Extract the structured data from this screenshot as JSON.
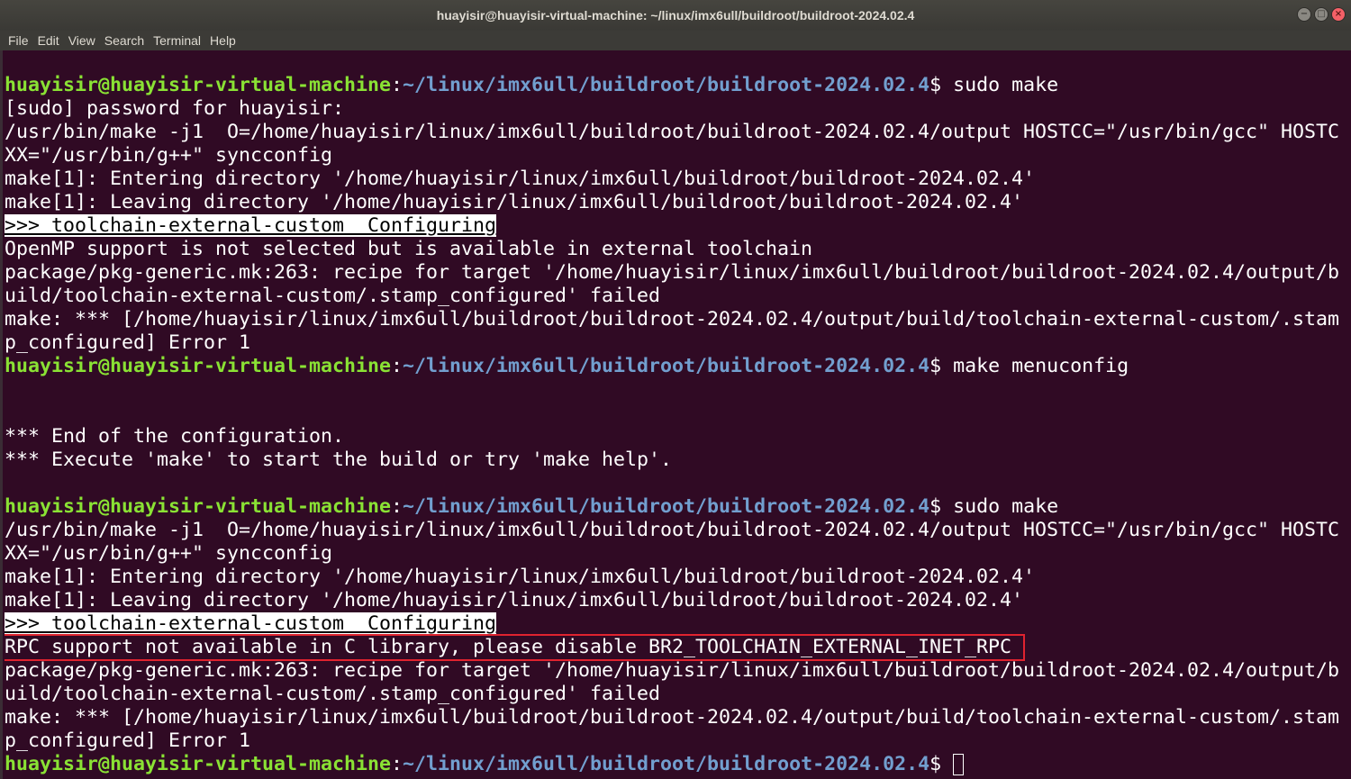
{
  "window": {
    "title": "huayisir@huayisir-virtual-machine: ~/linux/imx6ull/buildroot/buildroot-2024.02.4",
    "controls": {
      "minimize": "−",
      "maximize": "□",
      "close": "×"
    }
  },
  "menu": [
    "File",
    "Edit",
    "View",
    "Search",
    "Terminal",
    "Help"
  ],
  "prompt": {
    "user_host": "huayisir@huayisir-virtual-machine",
    "colon": ":",
    "path": "~/linux/imx6ull/buildroot/buildroot-2024.02.4",
    "symbol": "$"
  },
  "lines": [
    {
      "type": "prompt",
      "cmd": " sudo make"
    },
    {
      "type": "text",
      "text": "[sudo] password for huayisir:"
    },
    {
      "type": "text",
      "text": "/usr/bin/make -j1  O=/home/huayisir/linux/imx6ull/buildroot/buildroot-2024.02.4/output HOSTCC=\"/usr/bin/gcc\" HOSTC"
    },
    {
      "type": "text",
      "text": "XX=\"/usr/bin/g++\" syncconfig"
    },
    {
      "type": "text",
      "text": "make[1]: Entering directory '/home/huayisir/linux/imx6ull/buildroot/buildroot-2024.02.4'"
    },
    {
      "type": "text",
      "text": "make[1]: Leaving directory '/home/huayisir/linux/imx6ull/buildroot/buildroot-2024.02.4'"
    },
    {
      "type": "highlight",
      "text": ">>> toolchain-external-custom  Configuring"
    },
    {
      "type": "text",
      "text": "OpenMP support is not selected but is available in external toolchain"
    },
    {
      "type": "text",
      "text": "package/pkg-generic.mk:263: recipe for target '/home/huayisir/linux/imx6ull/buildroot/buildroot-2024.02.4/output/b"
    },
    {
      "type": "text",
      "text": "uild/toolchain-external-custom/.stamp_configured' failed"
    },
    {
      "type": "text",
      "text": "make: *** [/home/huayisir/linux/imx6ull/buildroot/buildroot-2024.02.4/output/build/toolchain-external-custom/.stam"
    },
    {
      "type": "text",
      "text": "p_configured] Error 1"
    },
    {
      "type": "prompt",
      "cmd": " make menuconfig"
    },
    {
      "type": "text",
      "text": ""
    },
    {
      "type": "text",
      "text": ""
    },
    {
      "type": "text",
      "text": "*** End of the configuration."
    },
    {
      "type": "text",
      "text": "*** Execute 'make' to start the build or try 'make help'."
    },
    {
      "type": "text",
      "text": ""
    },
    {
      "type": "prompt",
      "cmd": " sudo make"
    },
    {
      "type": "text",
      "text": "/usr/bin/make -j1  O=/home/huayisir/linux/imx6ull/buildroot/buildroot-2024.02.4/output HOSTCC=\"/usr/bin/gcc\" HOSTC"
    },
    {
      "type": "text",
      "text": "XX=\"/usr/bin/g++\" syncconfig"
    },
    {
      "type": "text",
      "text": "make[1]: Entering directory '/home/huayisir/linux/imx6ull/buildroot/buildroot-2024.02.4'"
    },
    {
      "type": "text",
      "text": "make[1]: Leaving directory '/home/huayisir/linux/imx6ull/buildroot/buildroot-2024.02.4'"
    },
    {
      "type": "highlight",
      "text": ">>> toolchain-external-custom  Configuring"
    },
    {
      "type": "boxed",
      "text": "RPC support not available in C library, please disable BR2_TOOLCHAIN_EXTERNAL_INET_RPC "
    },
    {
      "type": "text",
      "text": "package/pkg-generic.mk:263: recipe for target '/home/huayisir/linux/imx6ull/buildroot/buildroot-2024.02.4/output/b"
    },
    {
      "type": "text",
      "text": "uild/toolchain-external-custom/.stamp_configured' failed"
    },
    {
      "type": "text",
      "text": "make: *** [/home/huayisir/linux/imx6ull/buildroot/buildroot-2024.02.4/output/build/toolchain-external-custom/.stam"
    },
    {
      "type": "text",
      "text": "p_configured] Error 1"
    },
    {
      "type": "prompt-cursor",
      "cmd": " "
    }
  ],
  "colors": {
    "background": "#300a24",
    "prompt_user": "#8ae234",
    "prompt_path": "#729fcf",
    "text": "#ffffff",
    "error_box": "#e0232f"
  }
}
